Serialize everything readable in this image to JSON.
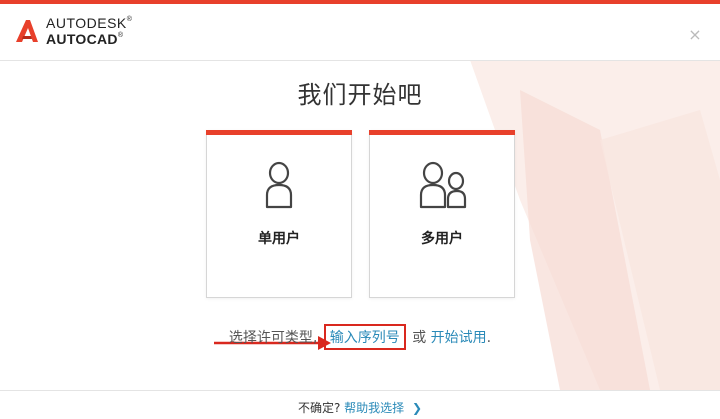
{
  "brand": {
    "line1": "AUTODESK",
    "line2": "AUTOCAD",
    "registered": "®"
  },
  "close_label": "×",
  "title": "我们开始吧",
  "cards": [
    {
      "label": "单用户",
      "icon": "single-user-icon"
    },
    {
      "label": "多用户",
      "icon": "multi-user-icon"
    }
  ],
  "license": {
    "prefix": "选择许可类型,",
    "serial_link": "输入序列号",
    "or": "或",
    "trial_link": "开始试用",
    "suffix": "."
  },
  "footer": {
    "question": "不确定?",
    "help_link": "帮助我选择",
    "chevron": "❯"
  },
  "colors": {
    "accent": "#e8402b",
    "link": "#2a8ab8",
    "highlight_box": "#d9281e"
  }
}
